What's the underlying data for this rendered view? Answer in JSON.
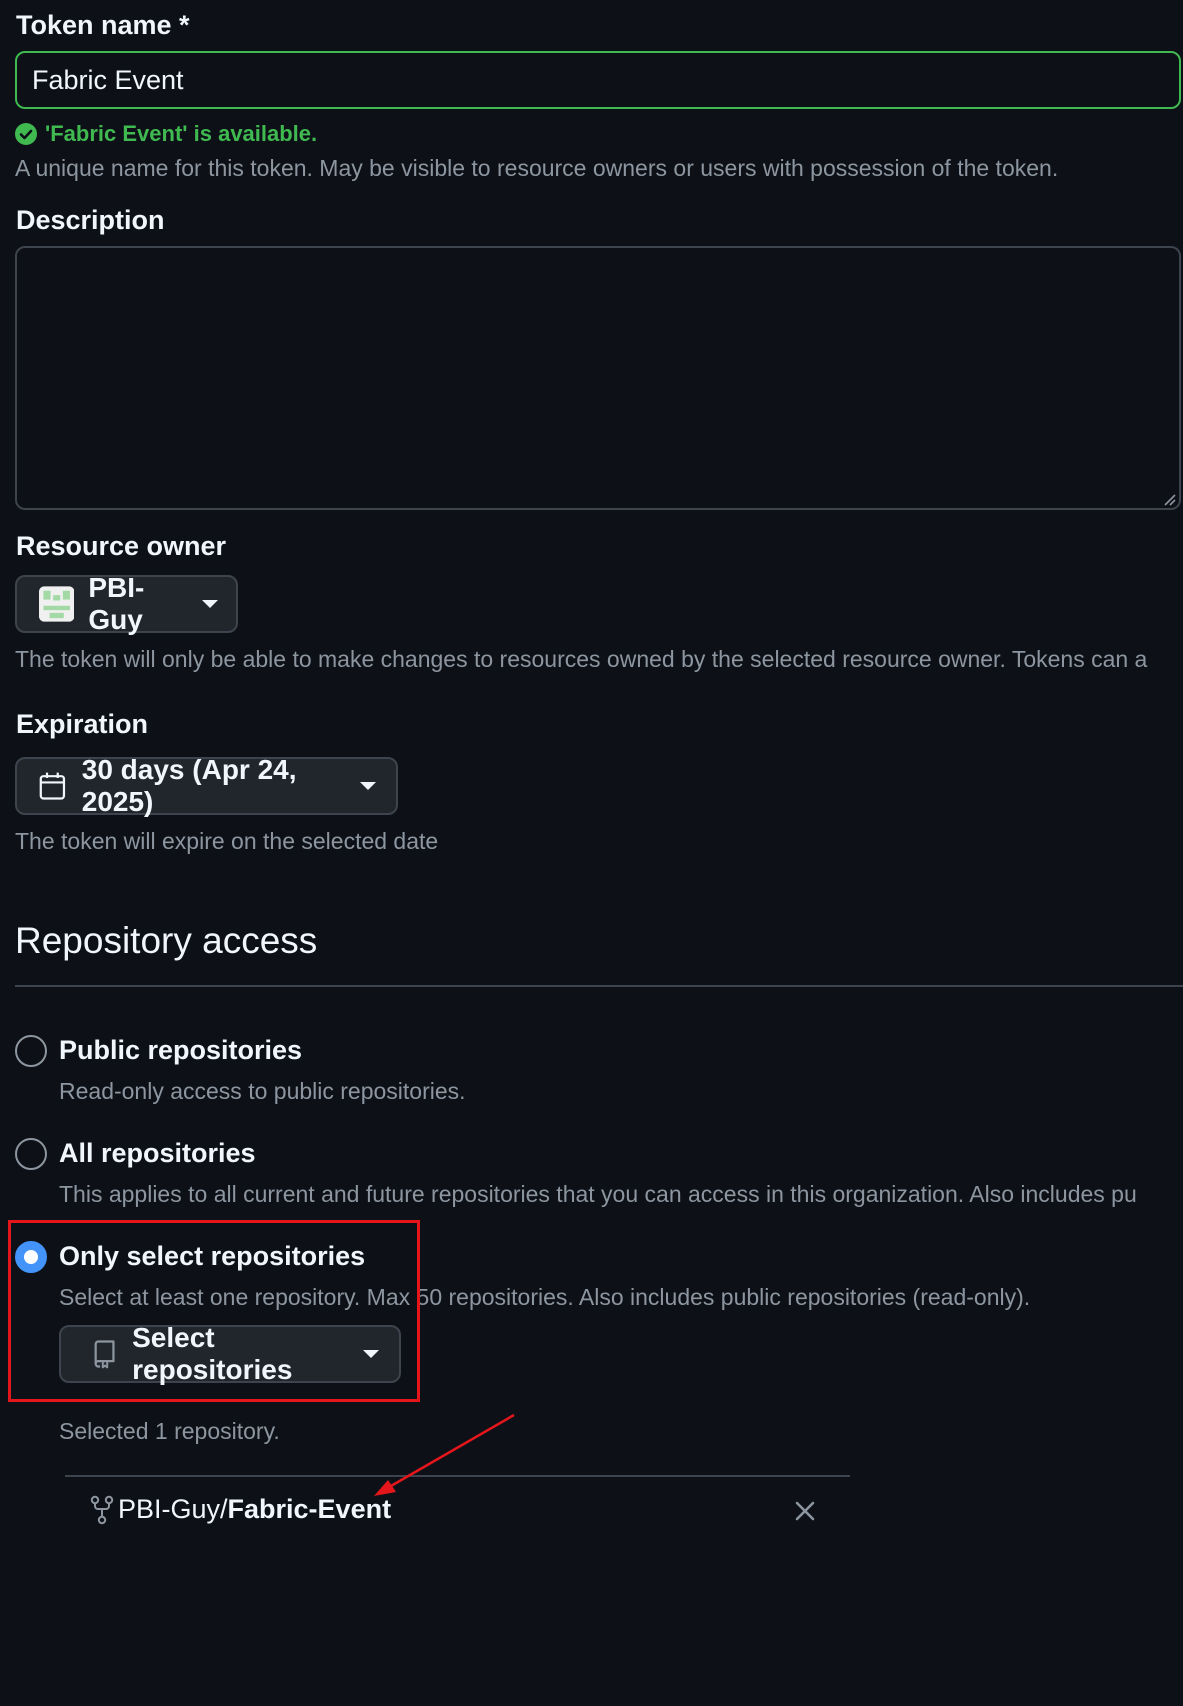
{
  "token_name": {
    "label": "Token name *",
    "value": "Fabric Event",
    "validation": "'Fabric Event' is available.",
    "help": "A unique name for this token. May be visible to resource owners or users with possession of the token."
  },
  "description": {
    "label": "Description",
    "value": ""
  },
  "resource_owner": {
    "label": "Resource owner",
    "selected": "PBI-Guy",
    "help": "The token will only be able to make changes to resources owned by the selected resource owner. Tokens can a"
  },
  "expiration": {
    "label": "Expiration",
    "selected": "30 days (Apr 24, 2025)",
    "help": "The token will expire on the selected date"
  },
  "repository_access": {
    "heading": "Repository access",
    "options": [
      {
        "label": "Public repositories",
        "description": "Read-only access to public repositories.",
        "checked": false
      },
      {
        "label": "All repositories",
        "description": "This applies to all current and future repositories that you can access in this organization. Also includes pu",
        "checked": false
      },
      {
        "label": "Only select repositories",
        "description": "Select at least one repository. Max 50 repositories. Also includes public repositories (read-only).",
        "checked": true
      }
    ],
    "select_button": "Select repositories",
    "selected_count": "Selected 1 repository.",
    "selected_repos": [
      {
        "owner": "PBI-Guy/",
        "name": "Fabric-Event"
      }
    ]
  },
  "colors": {
    "background": "#0d1117",
    "success": "#3fb950",
    "accent": "#4493f8",
    "annotation": "#e5161b"
  }
}
